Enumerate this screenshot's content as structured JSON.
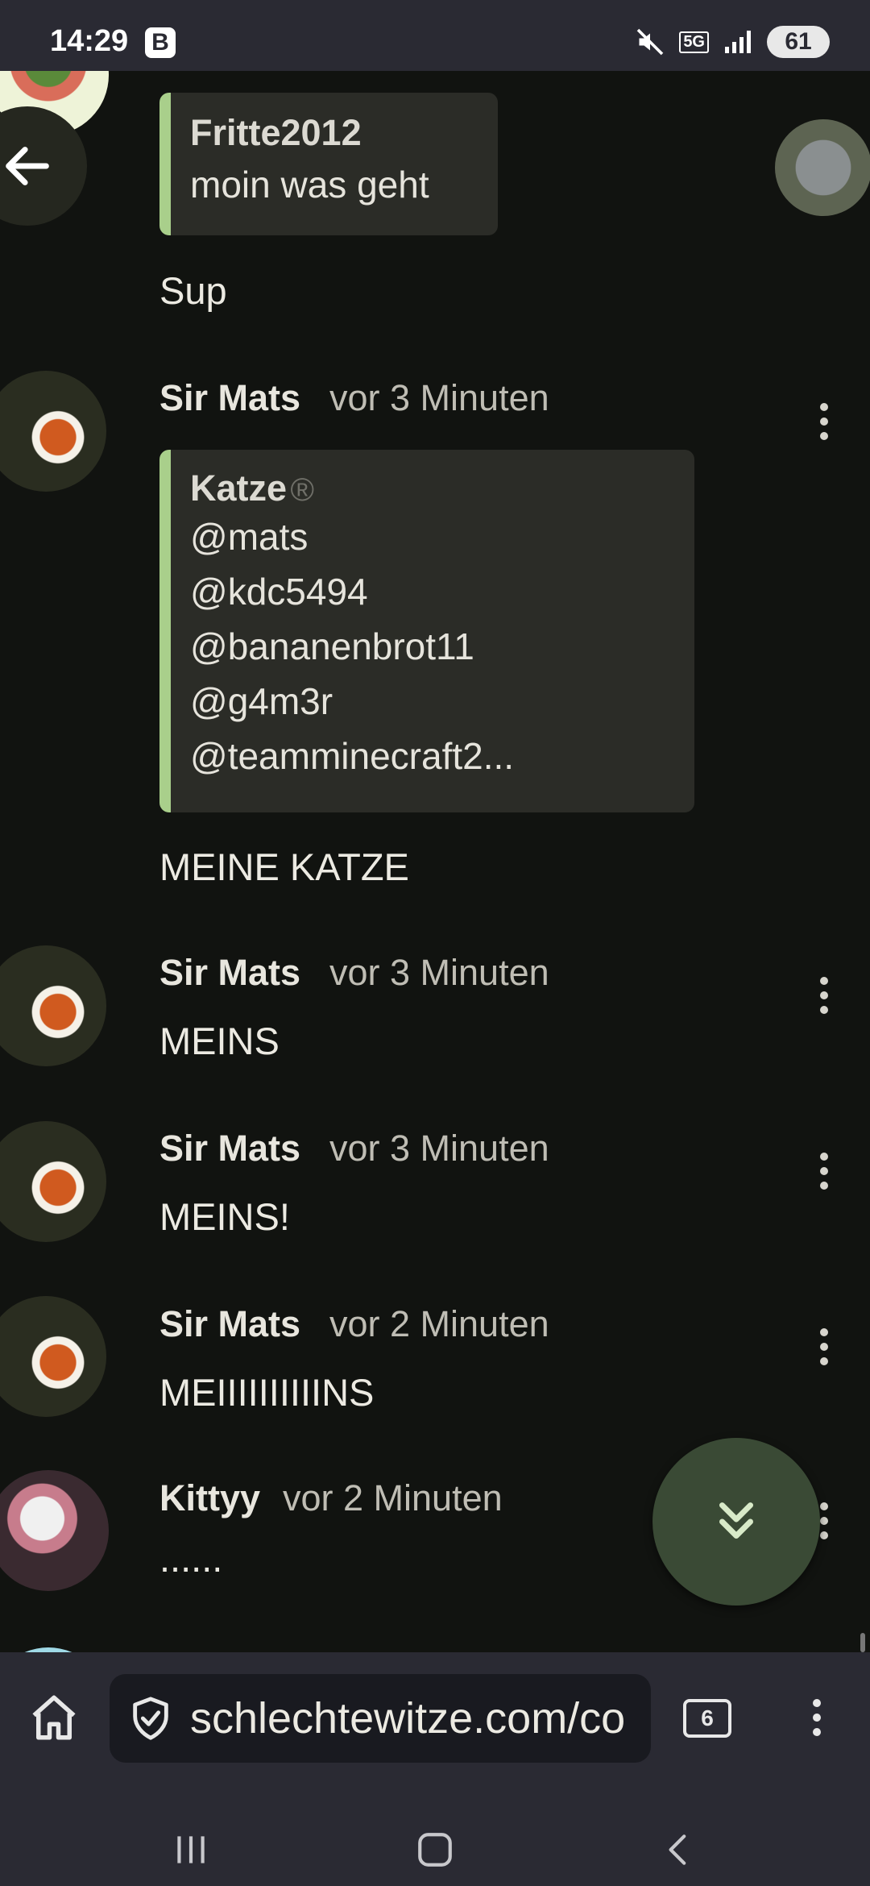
{
  "status_bar": {
    "time": "14:29",
    "b_badge": "B",
    "network": "5G",
    "battery": "61"
  },
  "messages": {
    "reply_quote": {
      "author": "Fritte2012",
      "text": "moin was geht"
    },
    "reply_text": "Sup",
    "m1": {
      "author": "Sir Mats",
      "time": "vor 3 Minuten",
      "quote_author": "Katze",
      "quote_author_badge": "®",
      "quote_lines": [
        "@mats",
        "@kdc5494",
        "@bananenbrot11",
        "@g4m3r",
        "@teamminecraft2..."
      ],
      "text": "MEINE KATZE"
    },
    "m2": {
      "author": "Sir Mats",
      "time": "vor 3 Minuten",
      "text": "MEINS"
    },
    "m3": {
      "author": "Sir Mats",
      "time": "vor 3 Minuten",
      "text": "MEINS!"
    },
    "m4": {
      "author": "Sir Mats",
      "time": "vor 2 Minuten",
      "text": "MEIIIIIIIIIINS"
    },
    "m5": {
      "author": "Kittyy",
      "time": "vor 2 Minuten",
      "text": "......"
    }
  },
  "browser": {
    "url": "schlechtewitze.com/co",
    "tab_count": "6"
  },
  "icons": {
    "back": "arrow-left-icon",
    "more": "kebab-icon",
    "scroll_down": "double-chevron-down-icon",
    "home": "home-icon",
    "security": "shield-check-icon",
    "tabs": "tab-switcher-icon"
  },
  "colors": {
    "background": "#111310",
    "quote_accent": "#a9cf8b",
    "fab": "#3a4a35",
    "bars": "#2a2a33"
  }
}
